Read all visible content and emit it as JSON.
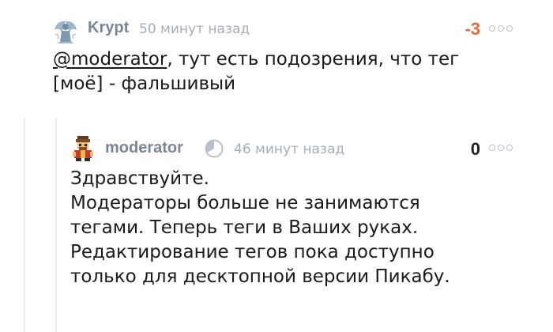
{
  "colors": {
    "negative_rating": "#e66a3d",
    "neutral_rating": "#222222",
    "author": "#7a8694",
    "timestamp": "#a5adb5",
    "thread_line": "#eeeeee"
  },
  "comments": [
    {
      "author": "Krypt",
      "time": "50 минут назад",
      "rating": "-3",
      "avatar_icon": "winged-figure-avatar",
      "mention": "@moderator",
      "line1_rest": ", тут есть подозрения, что тег",
      "line2": "[моё] - фальшивый"
    },
    {
      "author": "moderator",
      "time": "46 минут назад",
      "rating": "0",
      "avatar_icon": "pixel-character-avatar",
      "badge_icon": "pie-chart-icon",
      "lines": [
        "Здравствуйте.",
        "Модераторы больше не занимаются",
        "тегами. Теперь теги в Ваших руках.",
        "Редактирование тегов пока доступно",
        "только для десктопной версии Пикабу."
      ]
    }
  ]
}
